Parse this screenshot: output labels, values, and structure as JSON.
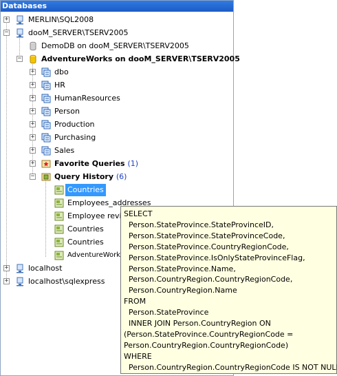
{
  "panel": {
    "title": "Databases"
  },
  "tree": [
    {
      "label": "MERLIN\\SQL2008",
      "icon": "server-icon"
    },
    {
      "label": "dooM_SERVER\\TSERV2005",
      "icon": "server-icon"
    },
    {
      "label": "DemoDB on dooM_SERVER\\TSERV2005",
      "icon": "database-icon"
    },
    {
      "label": "AdventureWorks on dooM_SERVER\\TSERV2005",
      "icon": "database-active-icon"
    },
    {
      "label": "dbo",
      "icon": "schema-icon"
    },
    {
      "label": "HR",
      "icon": "schema-icon"
    },
    {
      "label": "HumanResources",
      "icon": "schema-icon"
    },
    {
      "label": "Person",
      "icon": "schema-icon"
    },
    {
      "label": "Production",
      "icon": "schema-icon"
    },
    {
      "label": "Purchasing",
      "icon": "schema-icon"
    },
    {
      "label": "Sales",
      "icon": "schema-icon"
    },
    {
      "label": "Favorite Queries",
      "count": "(1)",
      "icon": "favorite-queries-icon"
    },
    {
      "label": "Query History",
      "count": "(6)",
      "icon": "query-history-icon"
    },
    {
      "label": "Countries",
      "icon": "query-icon"
    },
    {
      "label": "Employees_addresses",
      "icon": "query-icon"
    },
    {
      "label": "Employee reviews",
      "icon": "query-icon"
    },
    {
      "label": "Countries",
      "icon": "query-icon"
    },
    {
      "label": "Countries",
      "icon": "query-icon"
    },
    {
      "label": "AdventureWorks",
      "icon": "query-icon"
    },
    {
      "label": "localhost",
      "icon": "server-icon"
    },
    {
      "label": "localhost\\sqlexpress",
      "icon": "server-icon"
    }
  ],
  "tooltip": {
    "lines": [
      "SELECT",
      "  Person.StateProvince.StateProvinceID,",
      "  Person.StateProvince.StateProvinceCode,",
      "  Person.StateProvince.CountryRegionCode,",
      "  Person.StateProvince.IsOnlyStateProvinceFlag,",
      "  Person.StateProvince.Name,",
      "  Person.CountryRegion.CountryRegionCode,",
      "  Person.CountryRegion.Name",
      "FROM",
      "  Person.StateProvince",
      "  INNER JOIN Person.CountryRegion ON",
      "(Person.StateProvince.CountryRegionCode =",
      "Person.CountryRegion.CountryRegionCode)",
      "WHERE",
      "  Person.CountryRegion.CountryRegionCode IS NOT NULL"
    ]
  },
  "colors": {
    "header": "#2a6fd8",
    "selection": "#3399ff",
    "tooltip_bg": "#ffffe1",
    "count": "#1d3fc0"
  }
}
